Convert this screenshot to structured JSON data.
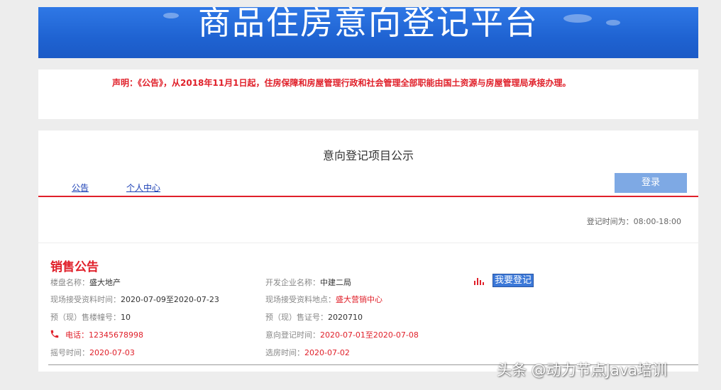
{
  "header": {
    "title": "商品住房意向登记平台"
  },
  "notice": {
    "text": "声明：《公告》，从2018年11月1日起，住房保障和房屋管理行政和社会管理全部职能由国土资源与房屋管理局承接办理。"
  },
  "main": {
    "section_title": "意向登记项目公示",
    "nav": [
      {
        "label": "公告"
      },
      {
        "label": "个人中心"
      }
    ],
    "login_label": "登录",
    "hours": "登记时间为：08:00-18:00"
  },
  "listing": {
    "title": "销售公告",
    "property_name_label": "楼盘名称：",
    "property_name": "盛大地产",
    "developer_label": "开发企业名称：",
    "developer": "中建二局",
    "register_label": "我要登记",
    "docs_time_label": "现场接受资料时间：",
    "docs_time": "2020-07-09至2020-07-23",
    "docs_place_label": "现场接受资料地点：",
    "docs_place": "盛大营销中心",
    "building_no_label": "预（现）售楼幢号：",
    "building_no": "10",
    "permit_label": "预（现）售证号：",
    "permit": "2020710",
    "phone_label": "电话：",
    "phone": "12345678998",
    "intent_time_label": "意向登记时间：",
    "intent_time": "2020-07-01至2020-07-08",
    "lottery_label": "摇号时间：",
    "lottery": "2020-07-03",
    "select_label": "选房时间：",
    "select": "2020-07-02"
  },
  "watermark": "头条 @动力节点Java培训",
  "colors": {
    "banner": "#1f63d2",
    "accent_red": "#e0202a",
    "login_button": "#7ea9e4",
    "link": "#1a3fb5"
  }
}
